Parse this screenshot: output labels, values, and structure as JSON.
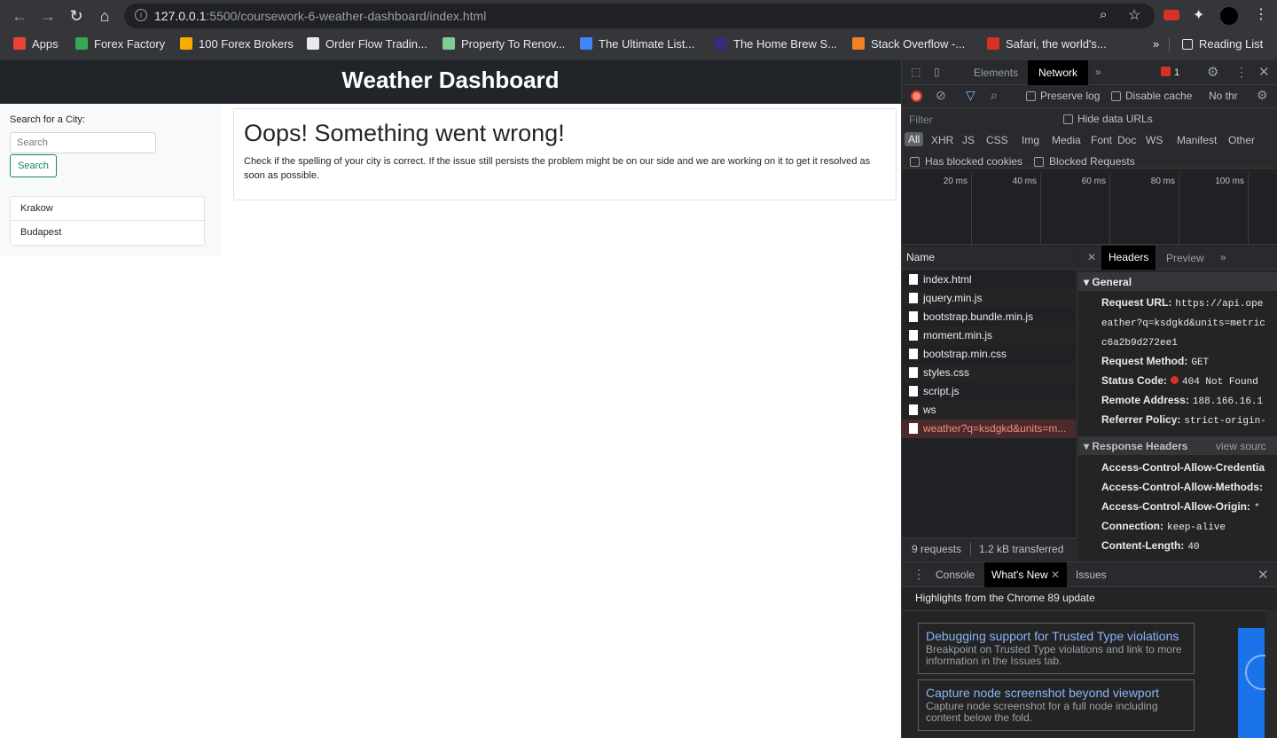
{
  "browser": {
    "url_host": "127.0.0.1",
    "url_rest": ":5500/coursework-6-weather-dashboard/index.html",
    "bookmarks": [
      {
        "label": "Apps",
        "color": "#ea4335"
      },
      {
        "label": "Forex Factory",
        "color": "#34a853"
      },
      {
        "label": "100 Forex Brokers",
        "color": "#f9ab00"
      },
      {
        "label": "Order Flow Tradin...",
        "color": "#e8eaed"
      },
      {
        "label": "Property To Renov...",
        "color": "#81c995"
      },
      {
        "label": "The Ultimate List...",
        "color": "#4285f4"
      },
      {
        "label": "The Home Brew S...",
        "color": "#3c2b7a"
      },
      {
        "label": "Stack Overflow -...",
        "color": "#f48024"
      },
      {
        "label": "Safari, the world's...",
        "color": "#d93025"
      }
    ],
    "reading_list": "Reading List"
  },
  "app": {
    "title": "Weather Dashboard",
    "search_label": "Search for a City:",
    "search_placeholder": "Search",
    "search_button": "Search",
    "history": [
      "Krakow",
      "Budapest"
    ],
    "error_title": "Oops! Something went wrong!",
    "error_text": "Check if the spelling of your city is correct. If the issue still persists the problem might be on our side and we are working on it to get it resolved as soon as possible."
  },
  "devtools": {
    "tabs": [
      "Elements",
      "Network"
    ],
    "error_count": "1",
    "preserve_log": "Preserve log",
    "disable_cache": "Disable cache",
    "throttle": "No thr",
    "filter_placeholder": "Filter",
    "hide_data_urls": "Hide data URLs",
    "type_filters": [
      "All",
      "XHR",
      "JS",
      "CSS",
      "Img",
      "Media",
      "Font",
      "Doc",
      "WS",
      "Manifest",
      "Other"
    ],
    "has_blocked_cookies": "Has blocked cookies",
    "blocked_requests": "Blocked Requests",
    "timeline": [
      "20 ms",
      "40 ms",
      "60 ms",
      "80 ms",
      "100 ms"
    ],
    "name_header": "Name",
    "requests": [
      "index.html",
      "jquery.min.js",
      "bootstrap.bundle.min.js",
      "moment.min.js",
      "bootstrap.min.css",
      "styles.css",
      "script.js",
      "ws",
      "weather?q=ksdgkd&units=m..."
    ],
    "summary_requests": "9 requests",
    "summary_transferred": "1.2 kB transferred",
    "detail_tabs": [
      "Headers",
      "Preview"
    ],
    "general_title": "General",
    "request_url_label": "Request URL:",
    "request_url_l1": "https://api.ope",
    "request_url_l2": "eather?q=ksdgkd&units=metric",
    "request_url_l3": "c6a2b9d272ee1",
    "method_label": "Request Method:",
    "method": "GET",
    "status_label": "Status Code:",
    "status": "404 Not Found",
    "remote_label": "Remote Address:",
    "remote": "188.166.16.1",
    "referrer_label": "Referrer Policy:",
    "referrer": "strict-origin-",
    "response_title": "Response Headers",
    "view_source": "view sourc",
    "acac": "Access-Control-Allow-Credentia",
    "acam": "Access-Control-Allow-Methods:",
    "acao_label": "Access-Control-Allow-Origin:",
    "acao": "*",
    "conn_label": "Connection:",
    "conn": "keep-alive",
    "len_label": "Content-Length:",
    "len": "40",
    "drawer_tabs": [
      "Console",
      "What's New",
      "Issues"
    ],
    "highlights": "Highlights from the Chrome 89 update",
    "tips": [
      {
        "title": "Debugging support for Trusted Type violations",
        "desc": "Breakpoint on Trusted Type violations and link to more information in the Issues tab."
      },
      {
        "title": "Capture node screenshot beyond viewport",
        "desc": "Capture node screenshot for a full node including content below the fold."
      }
    ]
  }
}
